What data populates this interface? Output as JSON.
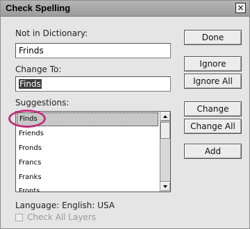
{
  "window": {
    "title": "Check Spelling",
    "close_glyph": "×"
  },
  "not_in_dictionary": {
    "label": "Not in Dictionary:",
    "value": "Frinds"
  },
  "change_to": {
    "label": "Change To:",
    "value": "Finds"
  },
  "suggestions": {
    "label": "Suggestions:",
    "items": [
      "Finds",
      "Friends",
      "Fronds",
      "Francs",
      "Franks",
      "Fronts"
    ],
    "selected_index": 0
  },
  "buttons": {
    "done": "Done",
    "ignore": "Ignore",
    "ignore_all": "Ignore All",
    "change": "Change",
    "change_all": "Change All",
    "add": "Add"
  },
  "language": {
    "label": "Language: English: USA"
  },
  "check_all_layers": {
    "label": "Check All Layers",
    "checked": false,
    "enabled": false
  },
  "colors": {
    "highlight_ellipse": "#c0307a"
  }
}
